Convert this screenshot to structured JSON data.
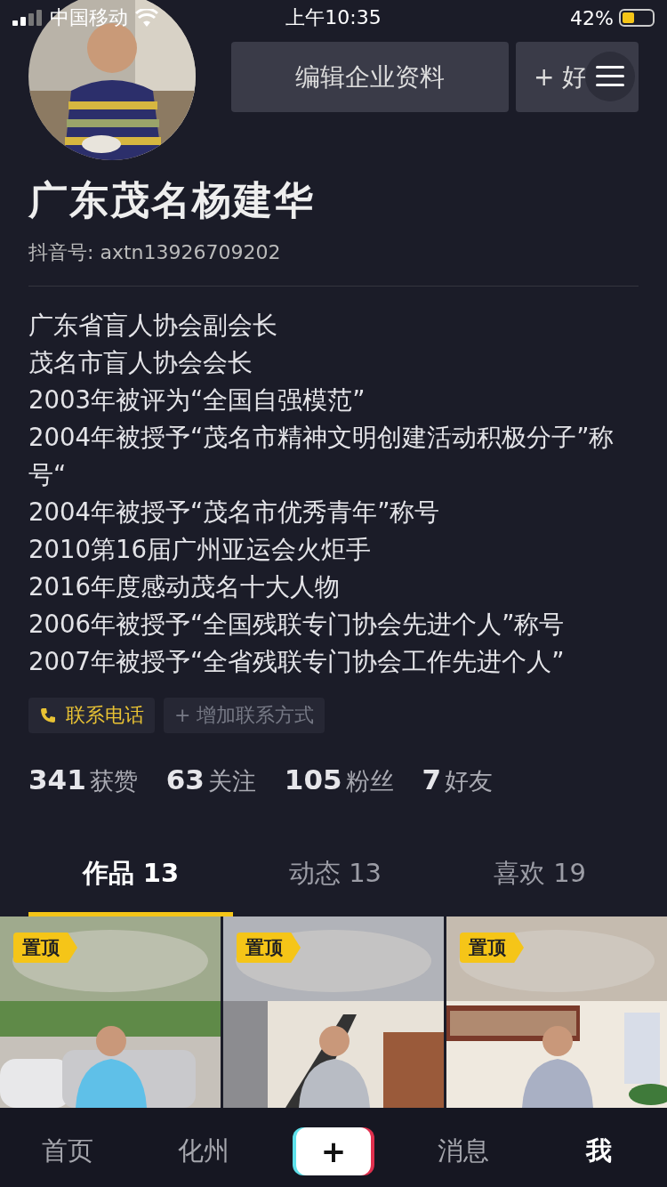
{
  "status_bar": {
    "carrier": "中国移动",
    "time": "上午10:35",
    "battery": "42%"
  },
  "header": {
    "edit_button": "编辑企业资料",
    "friend_button": "+ 好"
  },
  "profile": {
    "name": "广东茂名杨建华",
    "account_id": "抖音号: axtn13926709202"
  },
  "bio": [
    "广东省盲人协会副会长",
    "茂名市盲人协会会长",
    "2003年被评为“全国自强模范”",
    "2004年被授予“茂名市精神文明创建活动积极分子”称号“",
    "2004年被授予“茂名市优秀青年”称号",
    "2010第16届广州亚运会火炬手",
    "2016年度感动茂名十大人物",
    "2006年被授予“全国残联专门协会先进个人”称号",
    "2007年被授予“全省残联专门协会工作先进个人”"
  ],
  "contacts": [
    {
      "kind": "phone",
      "label": "联系电话"
    },
    {
      "kind": "add",
      "label": "+ 增加联系方式"
    }
  ],
  "stats": [
    {
      "count": "341",
      "label": "获赞"
    },
    {
      "count": "63",
      "label": "关注"
    },
    {
      "count": "105",
      "label": "粉丝"
    },
    {
      "count": "7",
      "label": "好友"
    }
  ],
  "tabs": [
    {
      "label": "作品 13",
      "selected": true
    },
    {
      "label": "动态 13",
      "selected": false
    },
    {
      "label": "喜欢 19",
      "selected": false
    }
  ],
  "videos": [
    {
      "badge": "置顶"
    },
    {
      "badge": "置顶"
    },
    {
      "badge": "置顶"
    }
  ],
  "bottom_nav": [
    {
      "kind": "text",
      "label": "首页",
      "selected": false
    },
    {
      "kind": "text",
      "label": "化州",
      "selected": false
    },
    {
      "kind": "create",
      "label": "+"
    },
    {
      "kind": "text",
      "label": "消息",
      "selected": false
    },
    {
      "kind": "text",
      "label": "我",
      "selected": true
    }
  ]
}
